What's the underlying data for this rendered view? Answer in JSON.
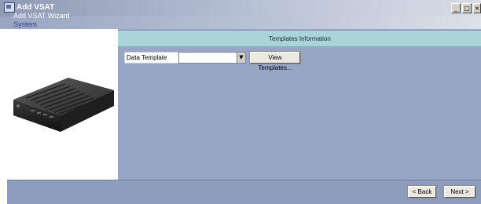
{
  "window": {
    "title": "Add VSAT",
    "controls": {
      "minimize": "_",
      "maximize": "□",
      "close": "×"
    }
  },
  "header": {
    "wizard_title": "Add VSAT Wizard",
    "step": "System"
  },
  "section": {
    "title": "Templates Information"
  },
  "form": {
    "data_template_label": "Data Template",
    "data_template_value": "",
    "view_templates_label": "View Templates..."
  },
  "footer": {
    "back_label": "< Back",
    "next_label": "Next >"
  },
  "icons": {
    "app": "vsat-app-icon",
    "device": "vsat-modem-image",
    "dropdown": "chevron-down-icon"
  },
  "colors": {
    "content_bg": "#98a6c6",
    "section_header_bg": "#a9d4d9",
    "footer_bg": "#8e9cbd"
  }
}
